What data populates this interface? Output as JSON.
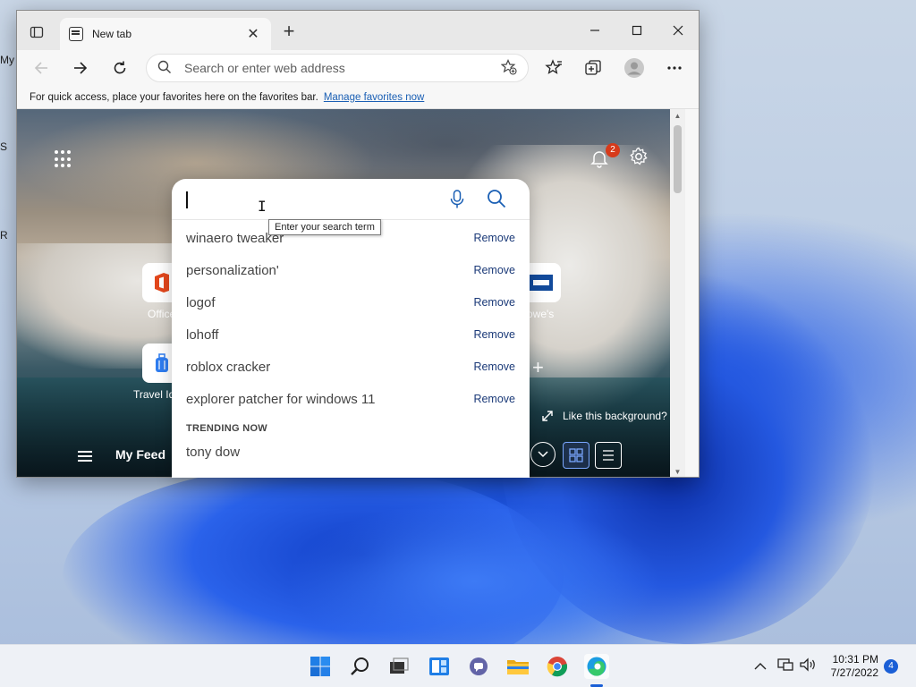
{
  "desktop": {
    "fragments": [
      "My",
      "S",
      "R"
    ]
  },
  "browser": {
    "tab_title": "New tab",
    "address_placeholder": "Search or enter web address",
    "favorites_bar": {
      "message": "For quick access, place your favorites here on the favorites bar.",
      "link": "Manage favorites now"
    }
  },
  "ntp": {
    "notification_count": "2",
    "tiles": [
      {
        "label": "Office",
        "icon": "office-icon"
      },
      {
        "label": "owe's",
        "icon": "lowes-icon"
      },
      {
        "label": "Travel Id",
        "icon": "luggage-icon"
      }
    ],
    "like_background": "Like this background?",
    "my_feed": "My Feed"
  },
  "search": {
    "tooltip": "Enter your search term",
    "suggestions": [
      {
        "query": "winaero tweaker",
        "action": "Remove"
      },
      {
        "query": "personalization'",
        "action": "Remove"
      },
      {
        "query": "logof",
        "action": "Remove"
      },
      {
        "query": "lohoff",
        "action": "Remove"
      },
      {
        "query": "roblox cracker",
        "action": "Remove"
      },
      {
        "query": "explorer patcher for windows 11",
        "action": "Remove"
      }
    ],
    "trending_label": "TRENDING NOW",
    "trending": [
      "tony dow"
    ]
  },
  "taskbar": {
    "apps": [
      "start-icon",
      "search-icon",
      "task-view-icon",
      "widgets-icon",
      "teams-chat-icon",
      "file-explorer-icon",
      "chrome-icon",
      "edge-icon"
    ],
    "time": "10:31 PM",
    "date": "7/27/2022",
    "notification_count": "4"
  },
  "colors": {
    "accent": "#1a5fb4",
    "badge": "#d73a1a",
    "taskbar": "#eef1f6"
  }
}
